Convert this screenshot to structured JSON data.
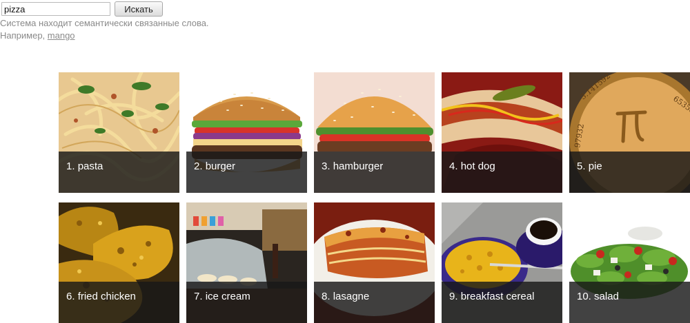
{
  "search": {
    "value": "pizza",
    "button_label": "Искать"
  },
  "hint": {
    "line1": "Система находит семантически связанные слова.",
    "example_prefix": "Например, ",
    "example_link": "mango"
  },
  "results": [
    {
      "rank": "1.",
      "label": "pasta"
    },
    {
      "rank": "2.",
      "label": "burger"
    },
    {
      "rank": "3.",
      "label": "hamburger"
    },
    {
      "rank": "4.",
      "label": "hot dog"
    },
    {
      "rank": "5.",
      "label": "pie"
    },
    {
      "rank": "6.",
      "label": "fried chicken"
    },
    {
      "rank": "7.",
      "label": "ice cream"
    },
    {
      "rank": "8.",
      "label": "lasagne"
    },
    {
      "rank": "9.",
      "label": "breakfast cereal"
    },
    {
      "rank": "10.",
      "label": "salad"
    }
  ]
}
